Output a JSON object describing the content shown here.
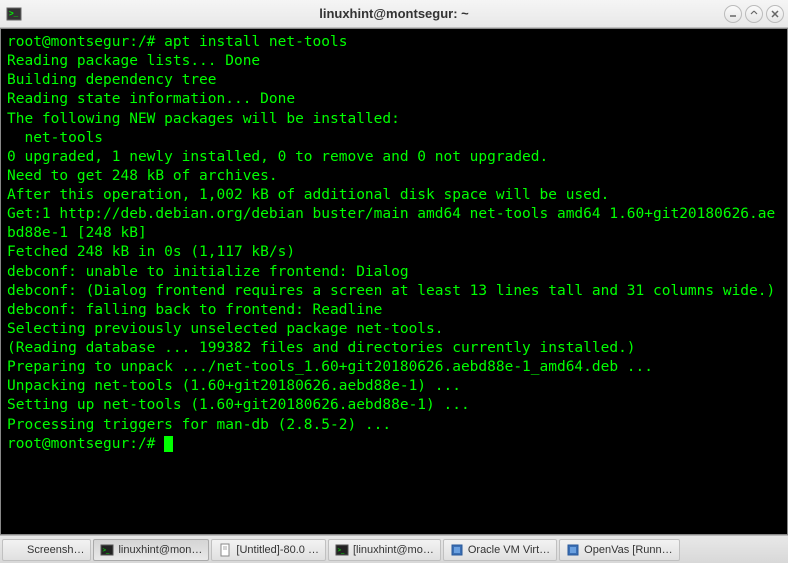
{
  "window": {
    "title": "linuxhint@montsegur: ~"
  },
  "terminal": {
    "prompt1": "root@montsegur:/# ",
    "command1": "apt install net-tools",
    "lines": [
      "Reading package lists... Done",
      "Building dependency tree",
      "Reading state information... Done",
      "The following NEW packages will be installed:",
      "  net-tools",
      "0 upgraded, 1 newly installed, 0 to remove and 0 not upgraded.",
      "Need to get 248 kB of archives.",
      "After this operation, 1,002 kB of additional disk space will be used.",
      "Get:1 http://deb.debian.org/debian buster/main amd64 net-tools amd64 1.60+git20180626.aebd88e-1 [248 kB]",
      "Fetched 248 kB in 0s (1,117 kB/s)",
      "debconf: unable to initialize frontend: Dialog",
      "debconf: (Dialog frontend requires a screen at least 13 lines tall and 31 columns wide.)",
      "debconf: falling back to frontend: Readline",
      "Selecting previously unselected package net-tools.",
      "(Reading database ... 199382 files and directories currently installed.)",
      "Preparing to unpack .../net-tools_1.60+git20180626.aebd88e-1_amd64.deb ...",
      "Unpacking net-tools (1.60+git20180626.aebd88e-1) ...",
      "Setting up net-tools (1.60+git20180626.aebd88e-1) ...",
      "Processing triggers for man-db (2.8.5-2) ..."
    ],
    "prompt2": "root@montsegur:/#"
  },
  "taskbar": {
    "items": [
      {
        "label": "Screensh…",
        "icon": ""
      },
      {
        "label": "linuxhint@mon…",
        "icon": "term"
      },
      {
        "label": "[Untitled]-80.0 …",
        "icon": "doc"
      },
      {
        "label": "[linuxhint@mo…",
        "icon": "term"
      },
      {
        "label": "Oracle VM Virt…",
        "icon": "vbox"
      },
      {
        "label": "OpenVas [Runn…",
        "icon": "vbox"
      }
    ]
  }
}
